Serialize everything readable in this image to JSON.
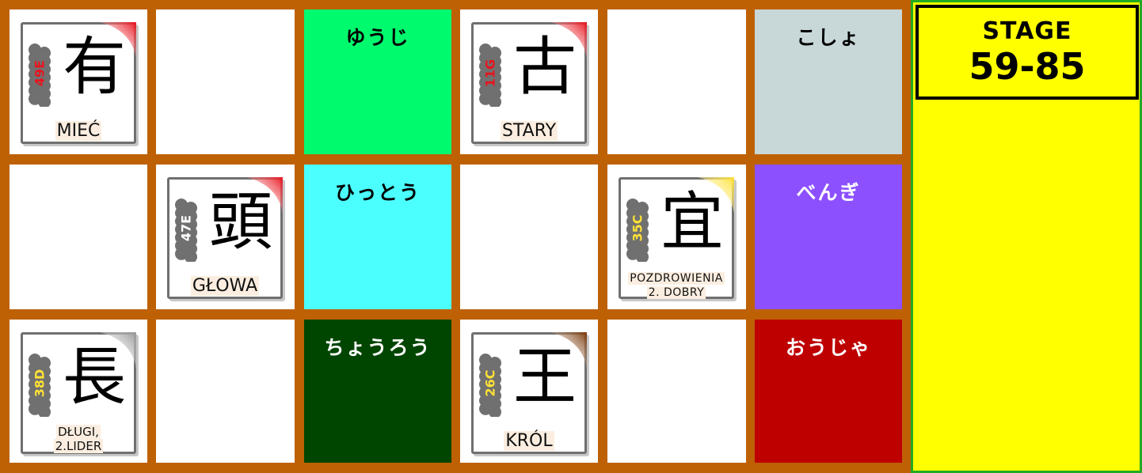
{
  "stage": {
    "title": "STAGE",
    "range": "59-85"
  },
  "grid": {
    "rows": [
      [
        {
          "type": "card",
          "kanji": "有",
          "code": "49E",
          "code_color": "#e8141e",
          "accent": "#e8141e",
          "meaning": "MIEĆ",
          "meaning_size": "lg"
        },
        {
          "type": "empty"
        },
        {
          "type": "reading",
          "reading": "ゆうじ",
          "bg": "#00fa6e",
          "text_color": "#000000"
        },
        {
          "type": "card",
          "kanji": "古",
          "code": "11G",
          "code_color": "#e8141e",
          "accent": "#e8141e",
          "meaning": "STARY",
          "meaning_size": "lg"
        },
        {
          "type": "empty"
        },
        {
          "type": "reading",
          "reading": "こしょ",
          "bg": "#c8d8d8",
          "text_color": "#000000"
        }
      ],
      [
        {
          "type": "empty"
        },
        {
          "type": "card",
          "kanji": "頭",
          "code": "47E",
          "code_color": "#ffffff",
          "accent": "#e8141e",
          "meaning": "GŁOWA",
          "meaning_size": "lg"
        },
        {
          "type": "reading",
          "reading": "ひっとう",
          "bg": "#4cffff",
          "text_color": "#000000"
        },
        {
          "type": "empty"
        },
        {
          "type": "card",
          "kanji": "宜",
          "code": "35C",
          "code_color": "#ffe135",
          "accent": "#ffe135",
          "meaning": "POZDROWIENIA",
          "meaning_line2": "2. DOBRY",
          "meaning_size": "xs"
        },
        {
          "type": "reading",
          "reading": "べんぎ",
          "bg": "#8c50ff",
          "text_color": "#ffffff"
        }
      ],
      [
        {
          "type": "card",
          "kanji": "長",
          "code": "38D",
          "code_color": "#ffe135",
          "accent": "#9a9a9a",
          "meaning": "DŁUGI,",
          "meaning_line2": "2.LIDER",
          "meaning_size": "sm"
        },
        {
          "type": "empty"
        },
        {
          "type": "reading",
          "reading": "ちょうろう",
          "bg": "#004600",
          "text_color": "#ffffff"
        },
        {
          "type": "card",
          "kanji": "王",
          "code": "26C",
          "code_color": "#ffe135",
          "accent": "#7a3a0a",
          "meaning": "KRÓL",
          "meaning_size": "lg"
        },
        {
          "type": "empty"
        },
        {
          "type": "reading",
          "reading": "おうじゃ",
          "bg": "#be0000",
          "text_color": "#ffffff"
        }
      ]
    ]
  }
}
